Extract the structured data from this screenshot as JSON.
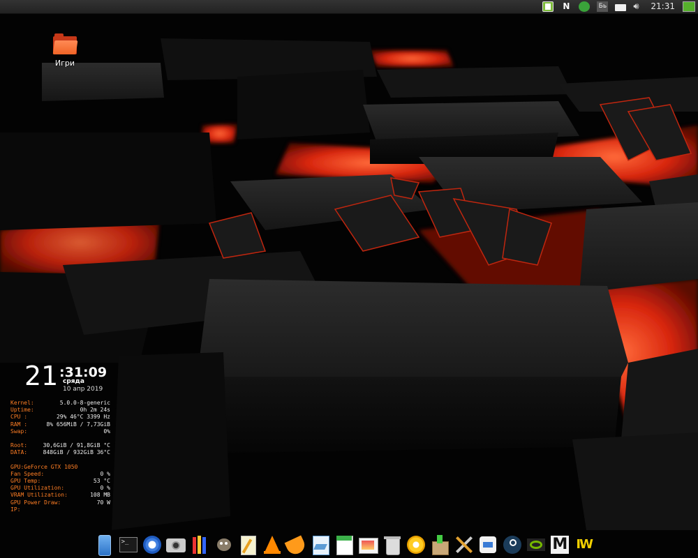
{
  "desktop": {
    "icons": [
      {
        "label": "Игри",
        "icon": "folder-icon"
      }
    ]
  },
  "top_panel": {
    "clock": "21:31",
    "tray": [
      "pastebin-icon",
      "notifier-icon",
      "update-manager-icon",
      "keyboard-layout-icon",
      "mail-icon",
      "volume-icon",
      "monitor-icon"
    ],
    "keyboard_layout": "Бь"
  },
  "conky": {
    "hours": "21",
    "minutes_seconds": ":31:09",
    "weekday": "сряда",
    "date": "10 апр 2019",
    "system": [
      {
        "key": "Kernel:",
        "value": "5.0.0-8-generic"
      },
      {
        "key": "Uptime:",
        "value": "0h 2m 24s"
      },
      {
        "key": "CPU :",
        "value": "29%  46°C 3399 Hz"
      },
      {
        "key": "RAM :",
        "value": "8% 656MiB / 7,73GiB"
      },
      {
        "key": "Swap:",
        "value": "0%"
      }
    ],
    "disks": [
      {
        "key": "Root:",
        "value": "30,6GiB / 91,8GiB  °C"
      },
      {
        "key": "DATA:",
        "value": "848GiB / 932GiB 36°C"
      }
    ],
    "gpu_title": "GPU:GeForce GTX 1050",
    "gpu": [
      {
        "key": "Fan Speed:",
        "value": "0 %"
      },
      {
        "key": "GPU Temp:",
        "value": "53 °C"
      },
      {
        "key": "GPU Utilization:",
        "value": "0 %"
      },
      {
        "key": "VRAM Utilization:",
        "value": "108 MB"
      },
      {
        "key": "GPU Power Draw:",
        "value": "70 W"
      },
      {
        "key": "IP:",
        "value": ""
      }
    ]
  },
  "dock": {
    "items": [
      "file-manager-icon",
      "terminal-icon",
      "browser-icon",
      "screenshot-icon",
      "pencils-icon",
      "gimp-icon",
      "text-editor-icon",
      "vlc-icon",
      "orange-slice-icon",
      "draw-icon",
      "notes-icon",
      "image-viewer-icon",
      "trash-icon",
      "settings-gear-icon",
      "software-install-icon",
      "tools-icon",
      "system-settings-icon",
      "steam-icon",
      "nvidia-icon",
      "m-app-icon",
      "wm-app-icon"
    ]
  },
  "colors": {
    "accent": "#ff7e24",
    "lava": "#ff3a14",
    "panel": "#2a2a2a"
  }
}
